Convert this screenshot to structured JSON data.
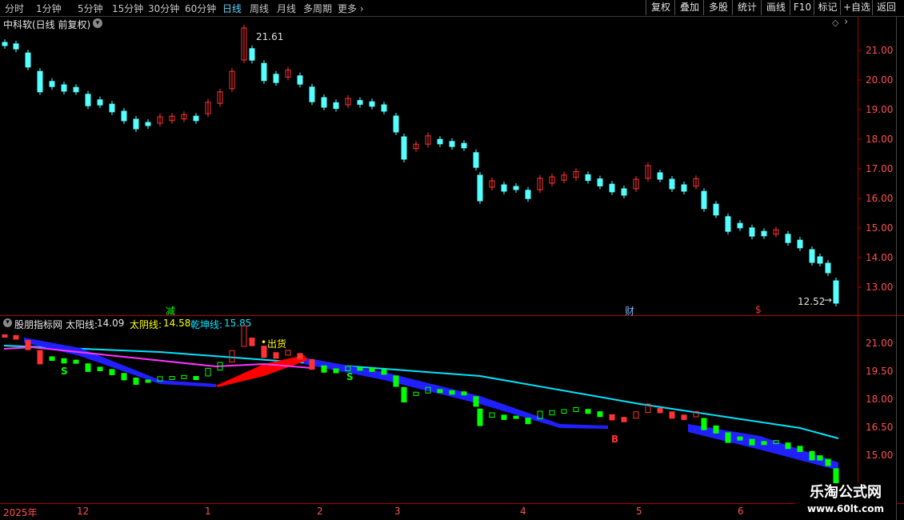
{
  "toolbar": {
    "timeframes": [
      "分时",
      "1分钟",
      "5分钟",
      "15分钟",
      "30分钟",
      "60分钟",
      "日线",
      "周线",
      "月线",
      "多周期",
      "更多"
    ],
    "active": "日线",
    "right_buttons": [
      "复权",
      "叠加",
      "多股",
      "统计",
      "画线",
      "F10",
      "标记",
      "+自选",
      "返回"
    ]
  },
  "main_pane": {
    "title": "中科软(日线 前复权)",
    "price_axis": [
      "21.00",
      "20.00",
      "19.00",
      "18.00",
      "17.00",
      "16.00",
      "15.00",
      "14.00",
      "13.00"
    ],
    "high_label": "21.61",
    "low_label": "12.52",
    "event_markers": [
      "减",
      "财",
      "$"
    ]
  },
  "indicator_pane": {
    "name": "股朋指标网",
    "sun_line_label": "太阳线:",
    "sun_line_value": "14.09",
    "moon_line_label": "太阴线:",
    "moon_line_value": "14.58",
    "qiankun_line_label": "乾坤线:",
    "qiankun_line_value": "15.85",
    "price_axis": [
      "21.00",
      "19.50",
      "18.00",
      "16.50",
      "15.00"
    ],
    "signal_sell": "出货",
    "signal_labels": [
      "S",
      "S",
      "B"
    ]
  },
  "time_axis": [
    "2025年",
    "12",
    "1",
    "2",
    "3",
    "4",
    "5",
    "6"
  ],
  "watermark": {
    "line1": "乐淘公式网",
    "line2": "www.60lt.com"
  },
  "colors": {
    "up": "#ff3333",
    "down": "#54ffff",
    "green": "#00ff00",
    "blue_band": "#2020ff",
    "red_band": "#ff0000",
    "cyan_line": "#00e5ff",
    "magenta_line": "#ff33ff",
    "yellow": "#ffff00"
  }
}
